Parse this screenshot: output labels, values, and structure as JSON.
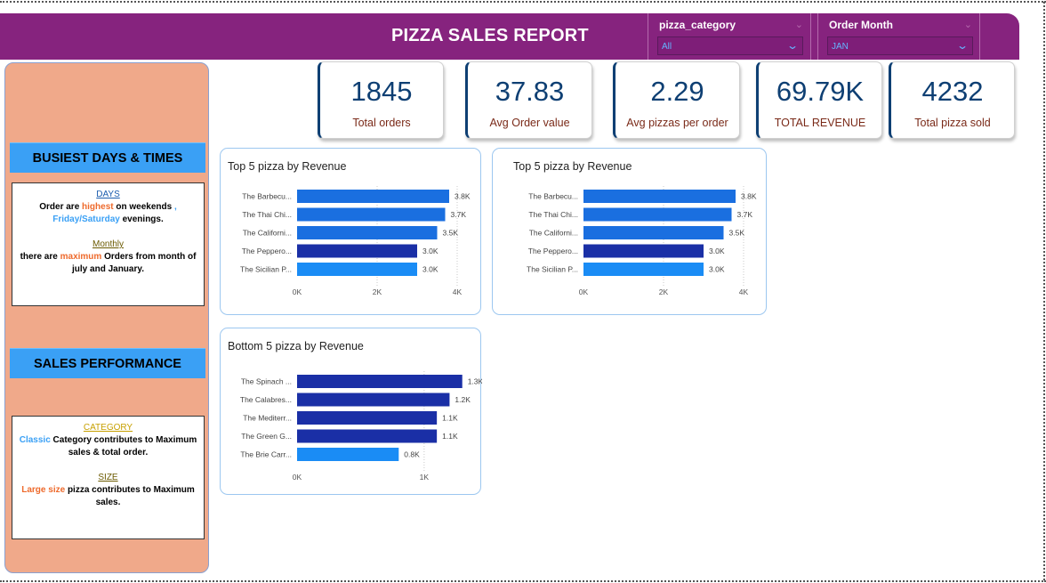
{
  "header": {
    "title": "PIZZA SALES REPORT"
  },
  "slicers": [
    {
      "label": "pizza_category",
      "value": "All"
    },
    {
      "label": "Order Month",
      "value": "JAN"
    }
  ],
  "sidebar": {
    "section1_title": "BUSIEST DAYS & TIMES",
    "section2_title": "SALES PERFORMANCE",
    "days_heading": "DAYS",
    "days_text_a": "Order are ",
    "days_text_highlight": "highest",
    "days_text_b": " on weekends ",
    "days_text_comma": ",",
    "days_text_days": "Friday/Saturday",
    "days_text_c": " evenings.",
    "monthly_heading": "Monthly ",
    "monthly_text_a": "there are ",
    "monthly_text_highlight": "maximum",
    "monthly_text_b": " Orders from month of july and January.",
    "category_heading": "CATEGORY",
    "category_text_highlight": "Classic",
    "category_text_b": " Category contributes to Maximum sales & total order.",
    "size_heading": "SIZE ",
    "size_text_highlight": "Large size",
    "size_text_b": " pizza contributes to Maximum sales."
  },
  "kpis": [
    {
      "value": "1845",
      "label": "Total orders"
    },
    {
      "value": "37.83",
      "label": "Avg Order value"
    },
    {
      "value": "2.29",
      "label": "Avg pizzas per order"
    },
    {
      "value": "69.79K",
      "label": "TOTAL REVENUE"
    },
    {
      "value": "4232",
      "label": "Total pizza sold"
    }
  ],
  "chart_data": [
    {
      "type": "bar",
      "orientation": "horizontal",
      "title": "Top 5 pizza by Revenue",
      "categories": [
        "The Barbecu...",
        "The Thai Chi...",
        "The Californi...",
        "The Peppero...",
        "The Sicilian P..."
      ],
      "values": [
        3.8,
        3.7,
        3.5,
        3.0,
        3.0
      ],
      "value_labels": [
        "3.8K",
        "3.7K",
        "3.5K",
        "3.0K",
        "3.0K"
      ],
      "bar_colors": [
        "#1a6fe0",
        "#1a6fe0",
        "#1a6fe0",
        "#1a2fa6",
        "#1a8cf5"
      ],
      "xticks": [
        "0K",
        "2K",
        "4K"
      ],
      "xlim": [
        0,
        4
      ]
    },
    {
      "type": "bar",
      "orientation": "horizontal",
      "title": "Top 5 pizza by Revenue",
      "categories": [
        "The Barbecu...",
        "The Thai Chi...",
        "The Californi...",
        "The Peppero...",
        "The Sicilian P..."
      ],
      "values": [
        3.8,
        3.7,
        3.5,
        3.0,
        3.0
      ],
      "value_labels": [
        "3.8K",
        "3.7K",
        "3.5K",
        "3.0K",
        "3.0K"
      ],
      "bar_colors": [
        "#1a6fe0",
        "#1a6fe0",
        "#1a6fe0",
        "#1a2fa6",
        "#1a8cf5"
      ],
      "xticks": [
        "0K",
        "2K",
        "4K"
      ],
      "xlim": [
        0,
        4
      ]
    },
    {
      "type": "bar",
      "orientation": "horizontal",
      "title": "Bottom 5 pizza by Revenue",
      "categories": [
        "The Spinach ...",
        "The Calabres...",
        "The Mediterr...",
        "The Green G...",
        "The Brie Carr..."
      ],
      "values": [
        1.3,
        1.2,
        1.1,
        1.1,
        0.8
      ],
      "value_labels": [
        "1.3K",
        "1.2K",
        "1.1K",
        "1.1K",
        "0.8K"
      ],
      "bar_colors": [
        "#1a2fa6",
        "#1a2fa6",
        "#1a2fa6",
        "#1a2fa6",
        "#1a8cf5"
      ],
      "xticks": [
        "0K",
        "1K"
      ],
      "xtick_values": [
        0,
        1
      ],
      "xlim": [
        0,
        1.4
      ]
    }
  ]
}
